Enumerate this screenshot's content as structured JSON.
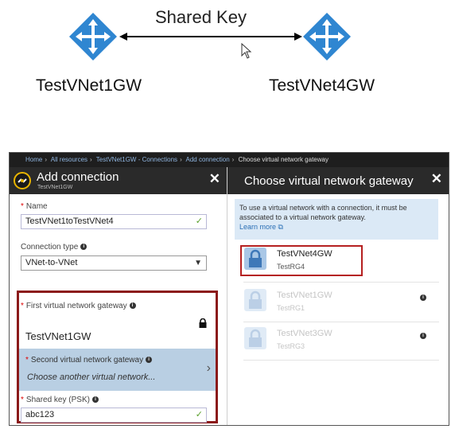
{
  "diagram": {
    "shared_label": "Shared Key",
    "left_gateway": "TestVNet1GW",
    "right_gateway": "TestVNet4GW"
  },
  "breadcrumb": [
    "Home",
    "All resources",
    "TestVNet1GW - Connections",
    "Add connection",
    "Choose virtual network gateway"
  ],
  "add_connection": {
    "title": "Add connection",
    "subtitle": "TestVNet1GW",
    "close": "✕",
    "name_label": "Name",
    "name_value": "TestVNet1toTestVNet4",
    "connection_type_label": "Connection type",
    "connection_type_value": "VNet-to-VNet",
    "first_gw_label": "First virtual network gateway",
    "first_gw_value": "TestVNet1GW",
    "second_gw_label": "Second virtual network gateway",
    "second_gw_value": "Choose another virtual network...",
    "shared_key_label": "Shared key (PSK)",
    "shared_key_value": "abc123"
  },
  "choose_gateway": {
    "title": "Choose virtual network gateway",
    "close": "✕",
    "info_text": "To use a virtual network with a connection, it must be associated to a virtual network gateway.",
    "learn_more": "Learn more",
    "gateways": [
      {
        "name": "TestVNet4GW",
        "rg": "TestRG4",
        "enabled": true
      },
      {
        "name": "TestVNet1GW",
        "rg": "TestRG1",
        "enabled": false
      },
      {
        "name": "TestVNet3GW",
        "rg": "TestRG3",
        "enabled": false
      }
    ]
  },
  "icons": {
    "gateway": "vpn-gateway-icon",
    "connection": "connection-icon",
    "lock": "lock-icon",
    "info": "info-icon",
    "check": "checkmark-icon",
    "chevron": "chevron-right-icon",
    "external_link": "external-link-icon"
  },
  "colors": {
    "gateway_blue": "#2f86d1",
    "highlight_red": "#8b1a1a",
    "selected_panel": "#b9cfe3",
    "info_panel": "#dbe9f6",
    "blade_header": "#2a2a2a"
  }
}
